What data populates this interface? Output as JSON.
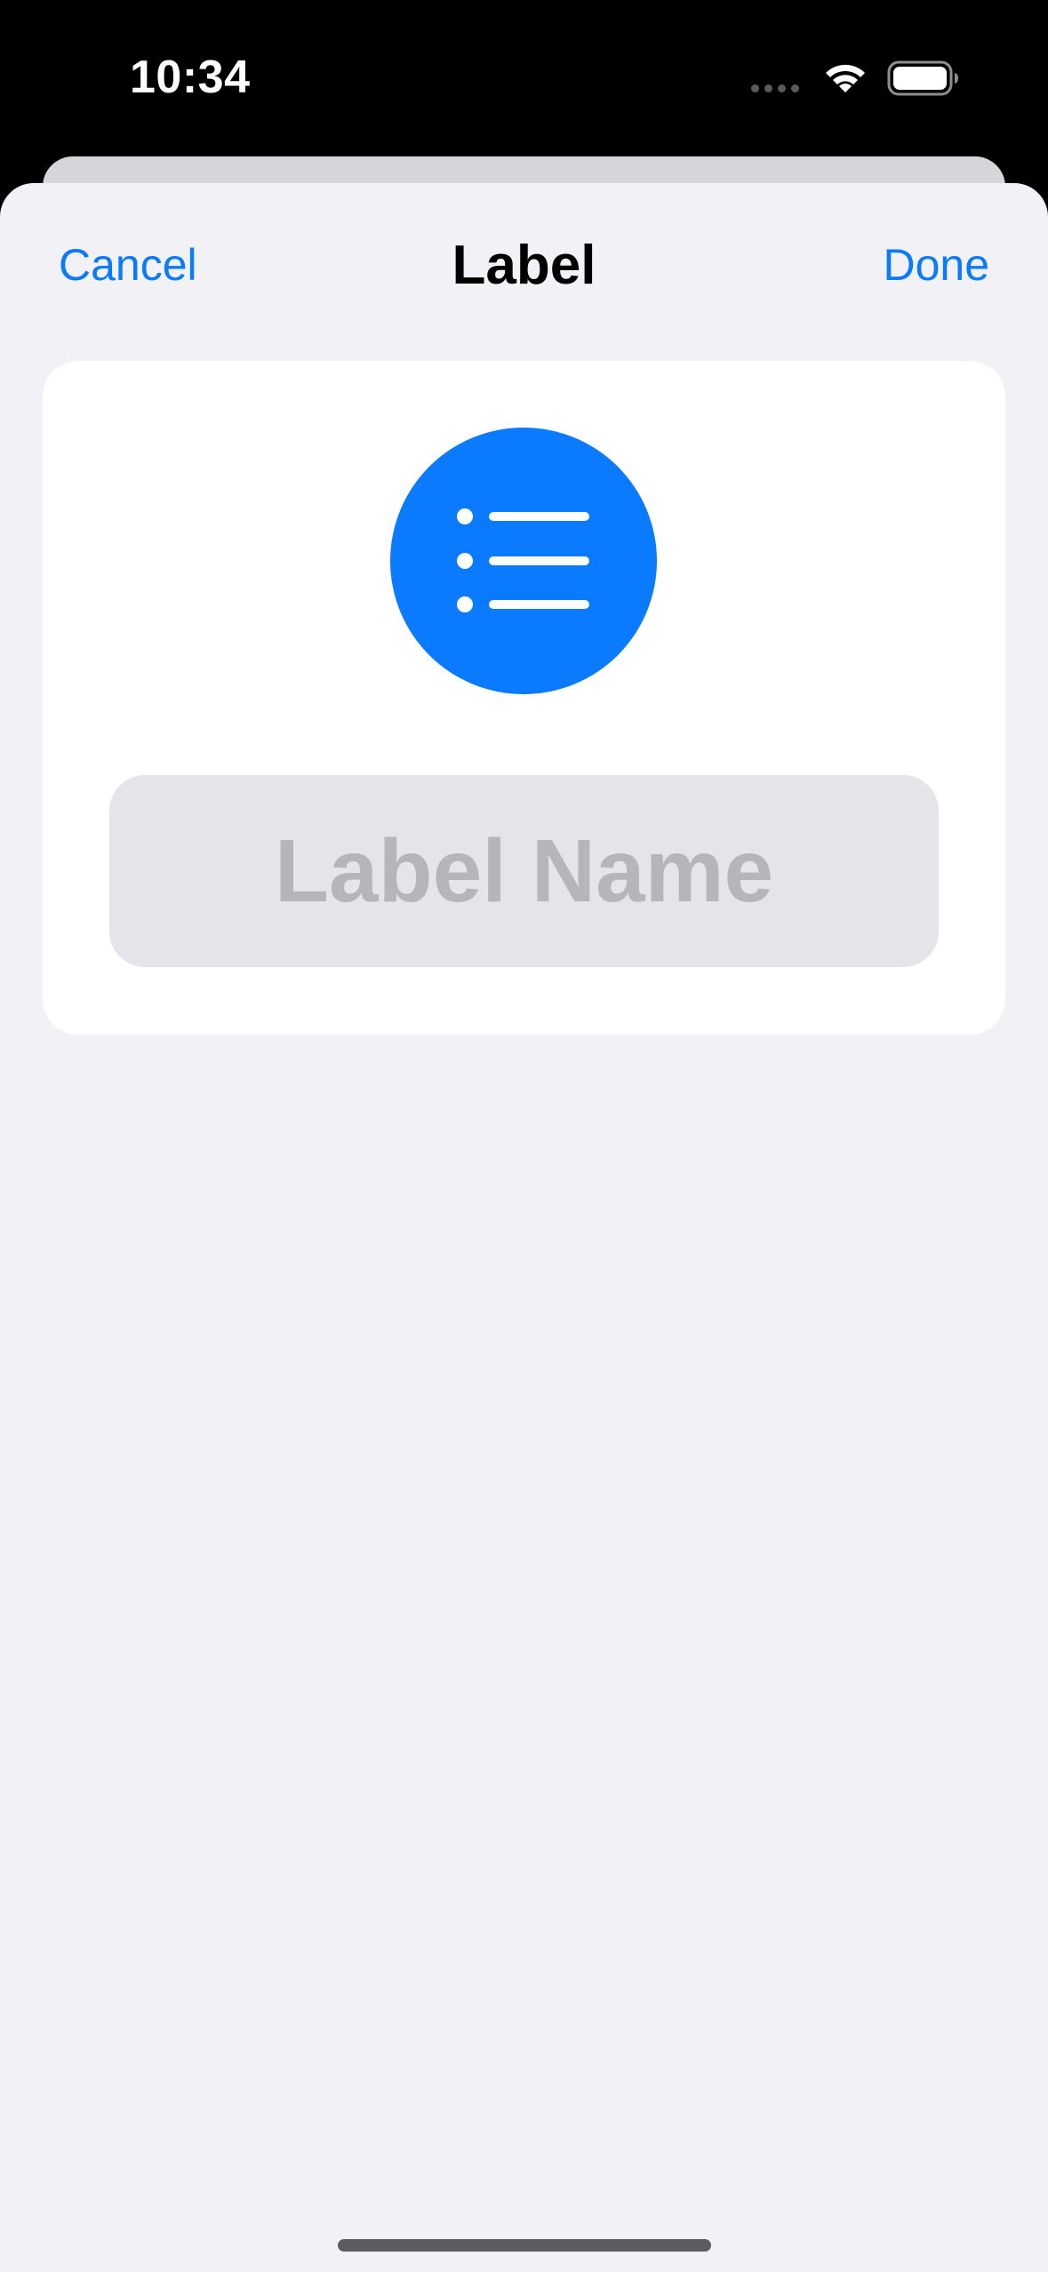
{
  "status_bar": {
    "time": "10:34",
    "wifi_icon": "wifi-icon",
    "battery_icon": "battery-icon"
  },
  "nav": {
    "cancel_label": "Cancel",
    "title": "Label",
    "done_label": "Done"
  },
  "card": {
    "icon": "list-bullet-icon",
    "icon_color": "#0a7aff",
    "name_field": {
      "placeholder": "Label Name",
      "value": ""
    }
  },
  "colors": {
    "accent": "#0a7aff",
    "sheet_background": "#f1f1f6",
    "field_background": "#e4e4e9"
  }
}
